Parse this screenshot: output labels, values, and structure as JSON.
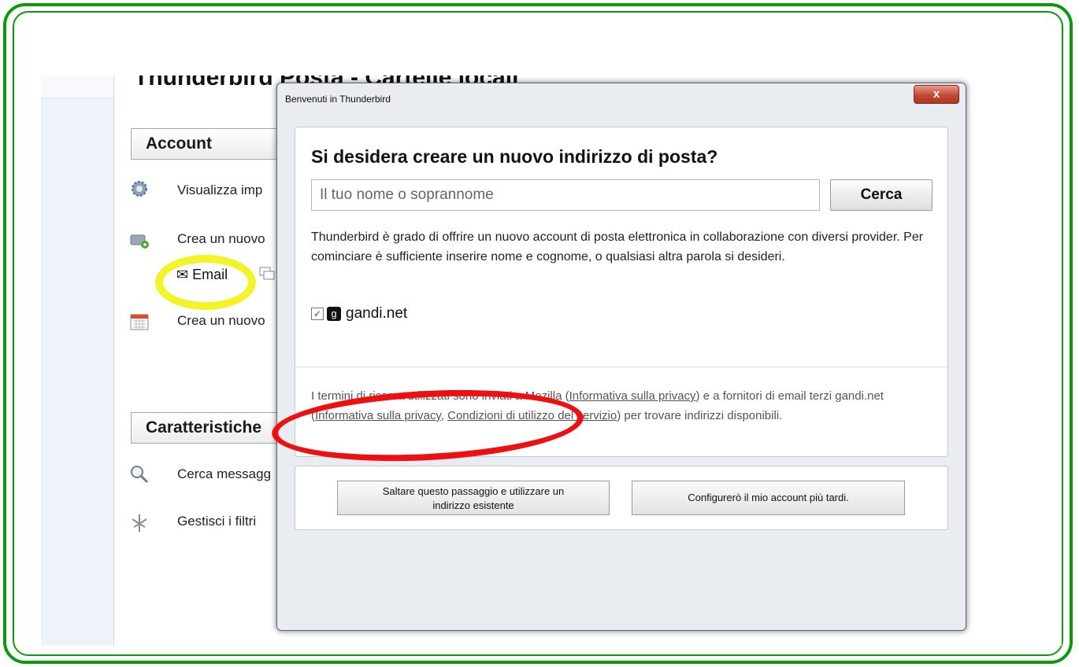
{
  "background_app": {
    "title": "Thunderbird Posta - Cartelle locali",
    "account_section": "Account",
    "rows": [
      "Visualizza imp",
      "Crea un nuovo",
      "Crea un nuovo"
    ],
    "email_link": "Email",
    "features_section": "Caratteristiche",
    "feature_rows": [
      "Cerca messagg",
      "Gestisci i filtri"
    ]
  },
  "dialog": {
    "title": "Benvenuti in Thunderbird",
    "close_label": "x",
    "heading": "Si desidera creare un nuovo indirizzo di posta?",
    "search_placeholder": "Il tuo nome o soprannome",
    "search_button": "Cerca",
    "description": "Thunderbird è grado di offrire un nuovo account di posta elettronica in collaborazione con diversi provider. Per cominciare è sufficiente inserire nome e cognome, o qualsiasi altra parola si desideri.",
    "provider": {
      "name": "gandi.net",
      "checked": true
    },
    "terms": {
      "part1": "I termini di ricerca utilizzati sono inviati a Mozilla (",
      "link1": "Informativa sulla privacy",
      "part2": ") e a fornitori di email terzi gandi.net (",
      "link2": "Informativa sulla privacy",
      "part3": ", ",
      "link3": "Condizioni di utilizzo del servizio",
      "part4": ") per trovare indirizzi disponibili."
    },
    "skip_button_line1": "Saltare questo passaggio e utilizzare un",
    "skip_button_line2": "indirizzo esistente",
    "later_button": "Configurerò il mio account più tardi."
  },
  "colors": {
    "frame": "#0b9a0b",
    "highlight_yellow": "#f3f329",
    "highlight_red": "#ee1010"
  }
}
